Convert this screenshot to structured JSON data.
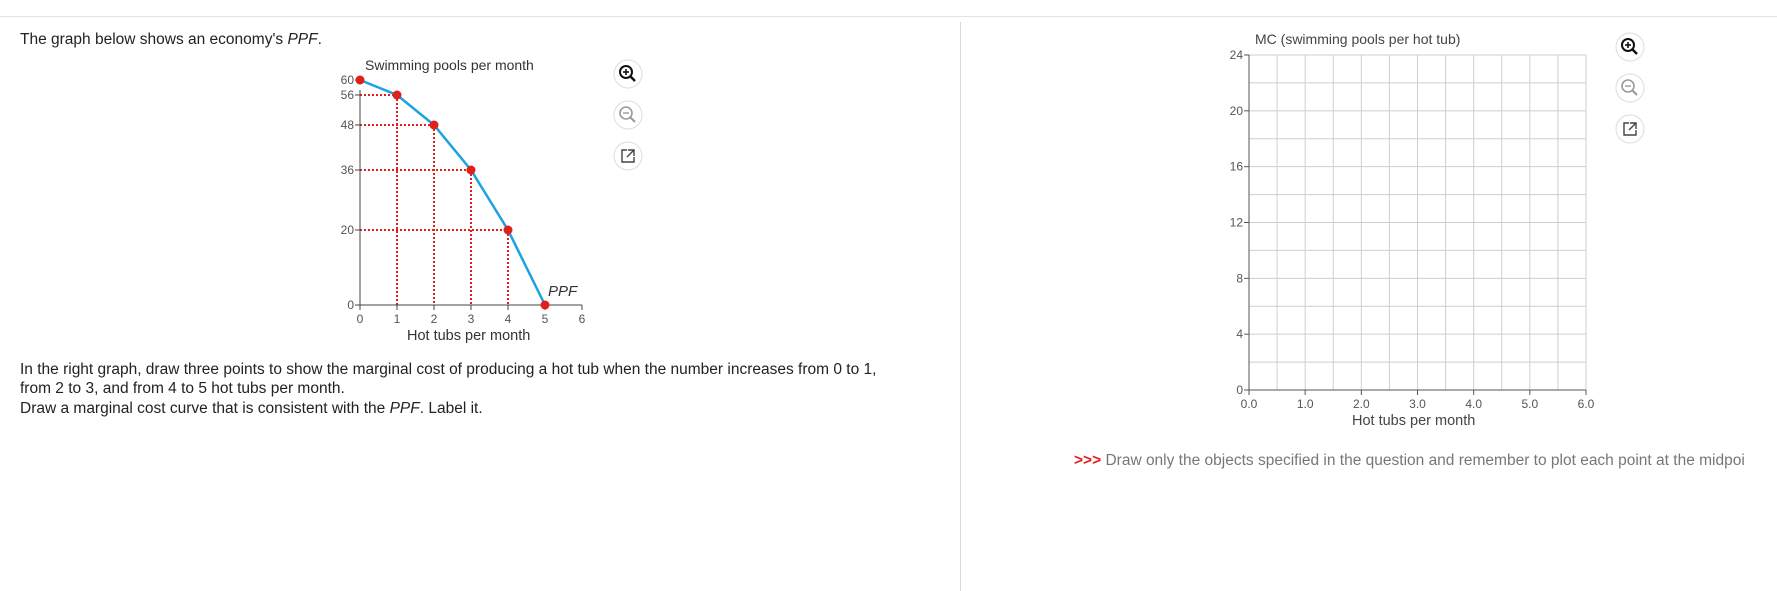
{
  "intro": {
    "text_before": "The graph below shows an economy's ",
    "ppf_italic": "PPF",
    "text_after": "."
  },
  "left_graph": {
    "y_axis_label": "Swimming pools per month",
    "x_axis_label": "Hot tubs per month",
    "curve_label": "PPF",
    "x_ticks": [
      "0",
      "1",
      "2",
      "3",
      "4",
      "5",
      "6"
    ],
    "y_ticks": [
      "0",
      "20",
      "36",
      "48",
      "56",
      "60"
    ],
    "curve_color": "#1aa3e0",
    "point_color": "#e0201d"
  },
  "question": {
    "line1": "In the right graph, draw three points to show the marginal cost of producing a hot tub when the number increases from 0 to 1,",
    "line2": "from 2 to 3, and from 4 to 5 hot tubs per month.",
    "line3_before": "Draw a marginal cost curve that is consistent with the ",
    "line3_italic": "PPF",
    "line3_after": ". Label it."
  },
  "right_graph": {
    "y_axis_label": "MC (swimming pools per hot tub)",
    "x_axis_label": "Hot tubs per month",
    "x_ticks": [
      "0.0",
      "1.0",
      "2.0",
      "3.0",
      "4.0",
      "5.0",
      "6.0"
    ],
    "y_ticks": [
      "0",
      "4",
      "8",
      "12",
      "16",
      "20",
      "24"
    ]
  },
  "hint": {
    "arrows": ">>>",
    "text": " Draw only the objects specified in the question and remember to plot each point at the midpoi"
  },
  "chart_data": {
    "type": "line",
    "x": [
      0,
      1,
      2,
      3,
      4,
      5
    ],
    "y": [
      60,
      56,
      48,
      36,
      20,
      0
    ],
    "series": [
      {
        "name": "PPF",
        "x": [
          0,
          1,
          2,
          3,
          4,
          5
        ],
        "y": [
          60,
          56,
          48,
          36,
          20,
          0
        ]
      }
    ],
    "xlabel": "Hot tubs per month",
    "ylabel": "Swimming pools per month",
    "xlim": [
      0,
      6
    ],
    "ylim": [
      0,
      60
    ]
  }
}
